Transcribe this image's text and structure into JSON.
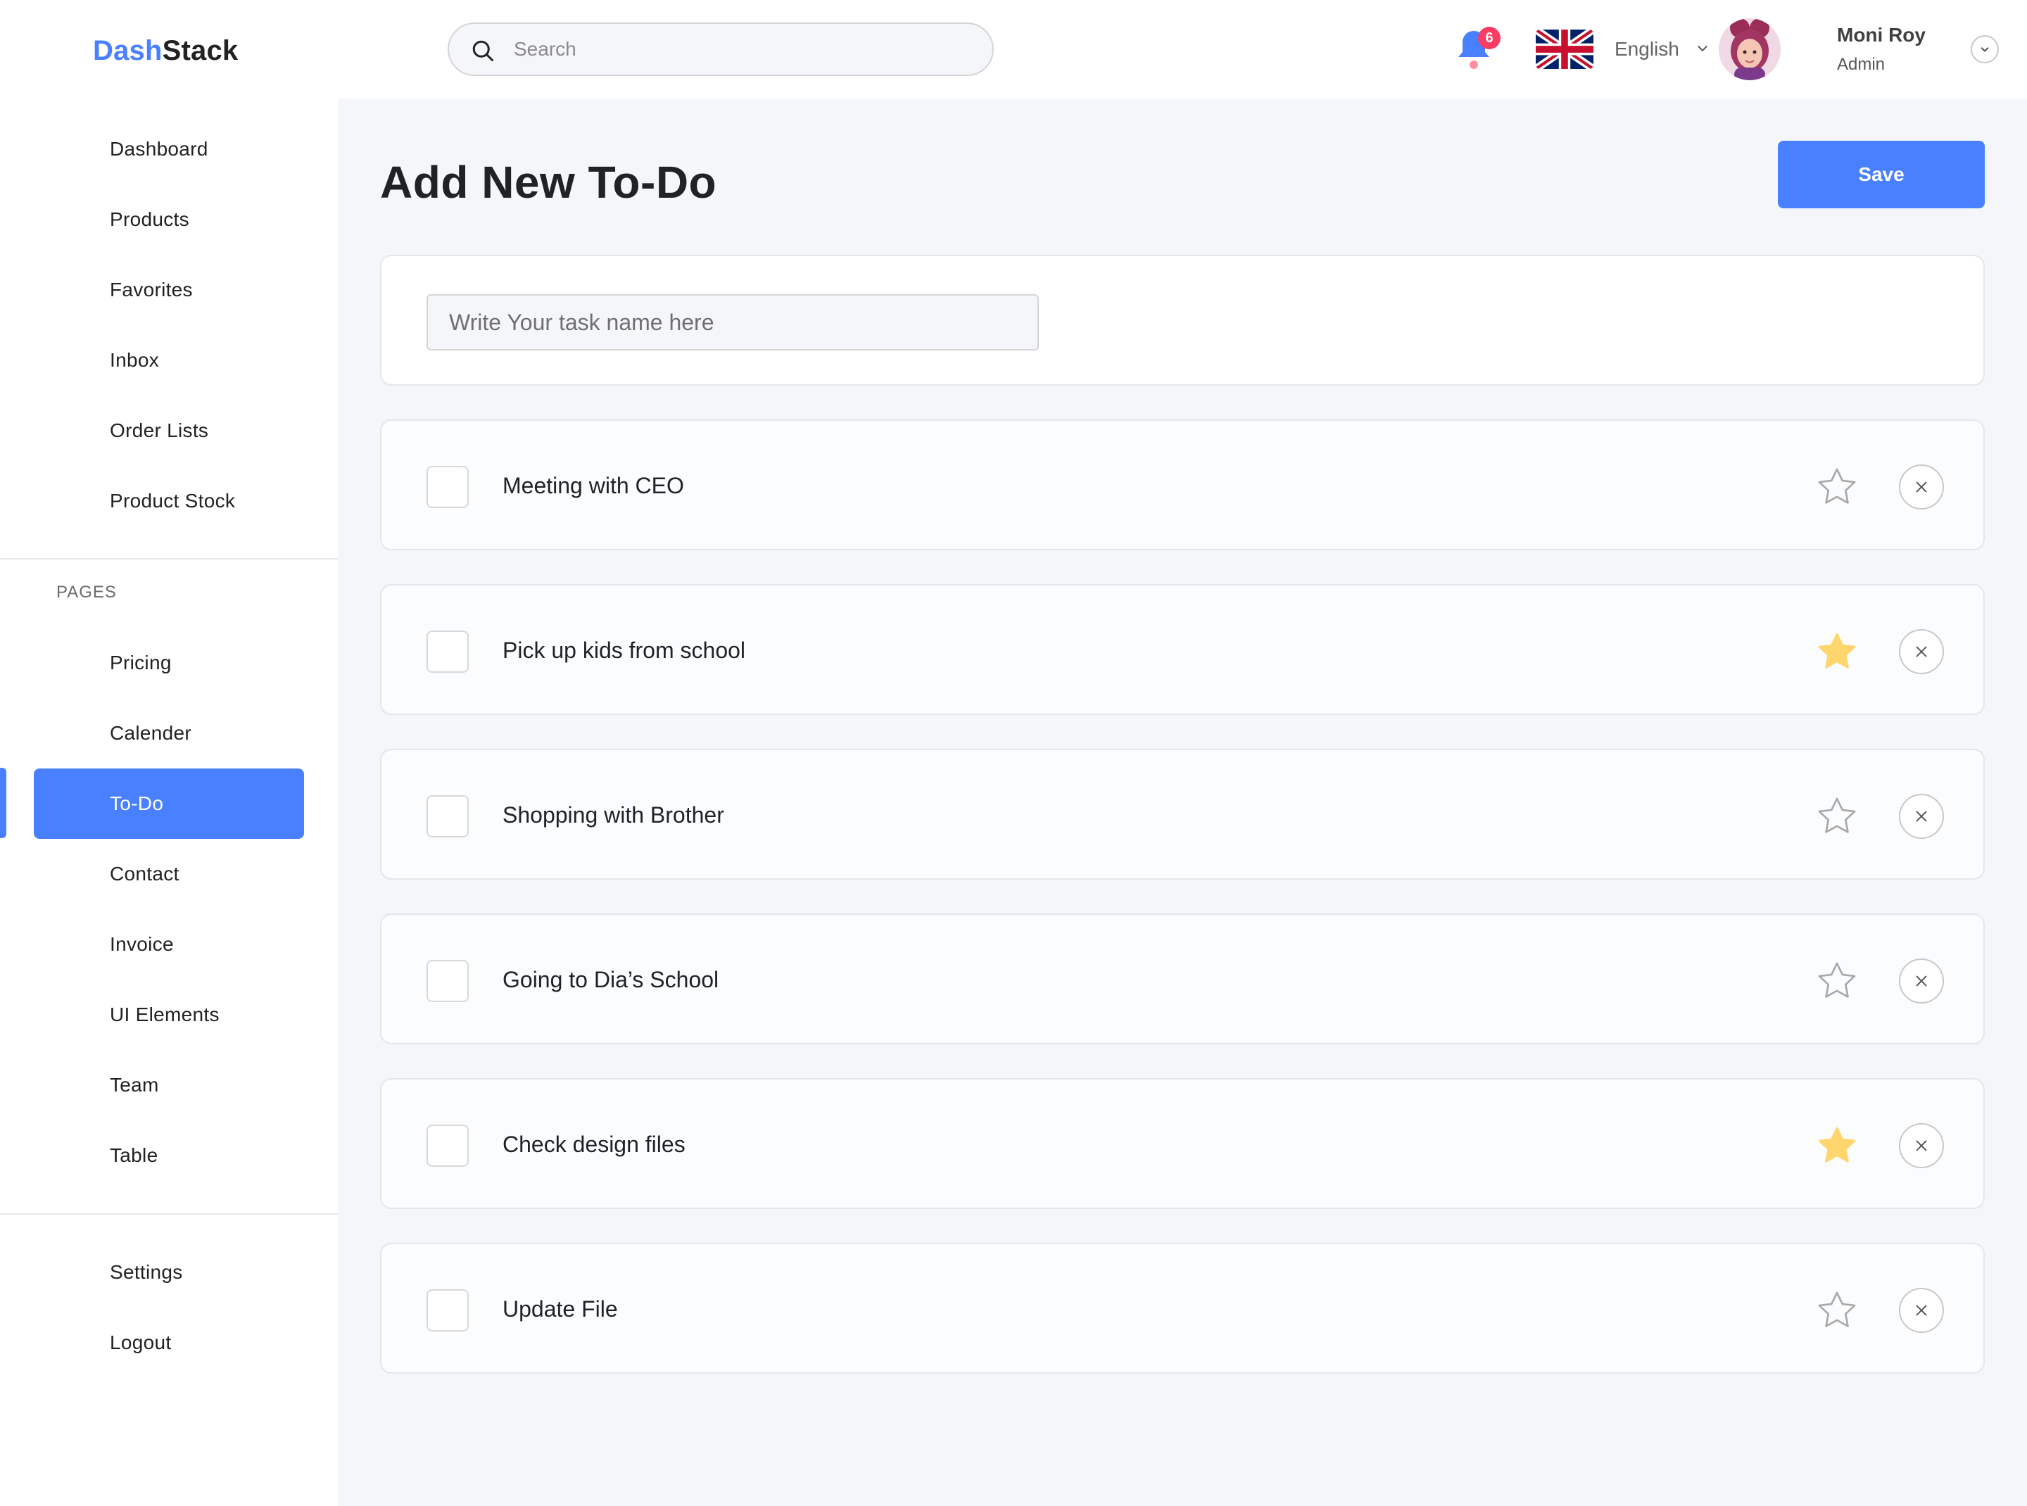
{
  "brand": {
    "part1": "Dash",
    "part2": "Stack",
    "accent": "#4880ff"
  },
  "sidebar": {
    "main_items": [
      {
        "label": "Dashboard"
      },
      {
        "label": "Products"
      },
      {
        "label": "Favorites"
      },
      {
        "label": "Inbox"
      },
      {
        "label": "Order Lists"
      },
      {
        "label": "Product Stock"
      }
    ],
    "section_label": "PAGES",
    "page_items": [
      {
        "label": "Pricing"
      },
      {
        "label": "Calender"
      },
      {
        "label": "To-Do",
        "active": true
      },
      {
        "label": "Contact"
      },
      {
        "label": "Invoice"
      },
      {
        "label": "UI Elements"
      },
      {
        "label": "Team"
      },
      {
        "label": "Table"
      }
    ],
    "bottom_items": [
      {
        "label": "Settings"
      },
      {
        "label": "Logout"
      }
    ]
  },
  "header": {
    "search_placeholder": "Search",
    "notifications_count": "6",
    "language": "English",
    "user": {
      "name": "Moni Roy",
      "role": "Admin"
    }
  },
  "main": {
    "title": "Add New To-Do",
    "save_label": "Save",
    "task_input_placeholder": "Write Your task name here",
    "tasks": [
      {
        "label": "Meeting with CEO",
        "starred": false,
        "checked": false
      },
      {
        "label": "Pick up kids from school",
        "starred": true,
        "checked": false
      },
      {
        "label": "Shopping with Brother",
        "starred": false,
        "checked": false
      },
      {
        "label": "Going to Dia’s School",
        "starred": false,
        "checked": false
      },
      {
        "label": "Check design files",
        "starred": true,
        "checked": false
      },
      {
        "label": "Update File",
        "starred": false,
        "checked": false
      }
    ]
  },
  "colors": {
    "primary": "#4880ff",
    "star_active": "#ffd56d",
    "badge": "#f93c65"
  },
  "icons": [
    "search-icon",
    "bell-icon",
    "uk-flag-icon",
    "chevron-down-icon",
    "star-icon",
    "close-icon"
  ]
}
